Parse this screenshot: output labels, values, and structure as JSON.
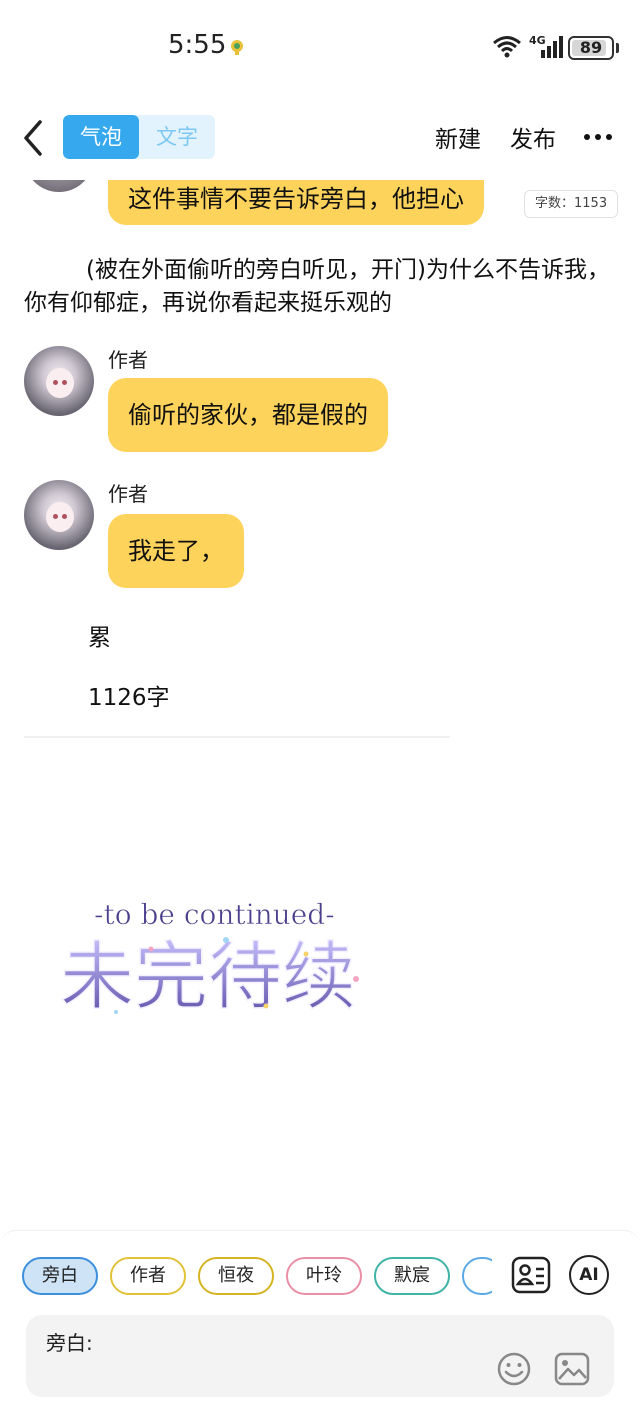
{
  "status_bar": {
    "time": "5:55",
    "network": "4G",
    "battery": "89",
    "battery_level": 0.89
  },
  "nav": {
    "mode_tabs": [
      "气泡",
      "文字"
    ],
    "active_tab": "气泡",
    "new_label": "新建",
    "publish_label": "发布",
    "back_icon": "chevron-left-icon",
    "more_icon": "more-dots-icon"
  },
  "content": {
    "partial_bubble": "这件事情不要告诉旁白，他担心",
    "word_count": "字数：1153",
    "narration": "(被在外面偷听的旁白听见，开门)为什么不告诉我，你有仰郁症，再说你看起来挺乐观的",
    "messages": [
      {
        "speaker": "作者",
        "text": "偷听的家伙，都是假的"
      },
      {
        "speaker": "作者",
        "text": "我走了，"
      }
    ],
    "line_1": "累",
    "line_2": "1126字",
    "image_caption_top": "-to be continued-",
    "image_caption_main": "未完待续"
  },
  "bottom": {
    "roles": [
      "旁白",
      "作者",
      "恒夜",
      "叶玲",
      "默宸",
      ""
    ],
    "selected_role": "旁白",
    "ai_label": "AI",
    "input_label": "旁白:",
    "icons": [
      "roles-card-icon",
      "smiley-icon",
      "image-icon"
    ]
  },
  "colors": {
    "accent": "#36a9ee",
    "bubble": "#fdd35c"
  }
}
